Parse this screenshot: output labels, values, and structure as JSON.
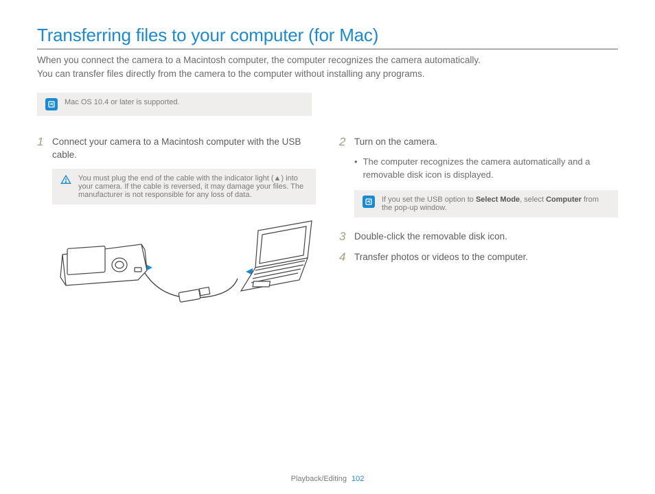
{
  "title": "Transferring files to your computer (for Mac)",
  "intro_line1": "When you connect the camera to a Macintosh computer, the computer recognizes the camera automatically.",
  "intro_line2": "You can transfer files directly from the camera to the computer without installing any programs.",
  "top_note": "Mac OS 10.4 or later is supported.",
  "steps": {
    "s1": {
      "num": "1",
      "text": "Connect your camera to a Macintosh computer with the USB cable.",
      "warning": "You must plug the end of the cable with the indicator light (▲) into your camera. If the cable is reversed, it may damage your files. The manufacturer is not responsible for any loss of data."
    },
    "s2": {
      "num": "2",
      "text": "Turn on the camera.",
      "bullet": "The computer recognizes the camera automatically and a removable disk icon is displayed.",
      "note_prefix": "If you set the USB option to ",
      "note_bold1": "Select Mode",
      "note_mid": ", select ",
      "note_bold2": "Computer",
      "note_suffix": " from the pop-up window."
    },
    "s3": {
      "num": "3",
      "text": "Double-click the removable disk icon."
    },
    "s4": {
      "num": "4",
      "text": "Transfer photos or videos to the computer."
    }
  },
  "footer": {
    "section": "Playback/Editing",
    "page": "102"
  }
}
